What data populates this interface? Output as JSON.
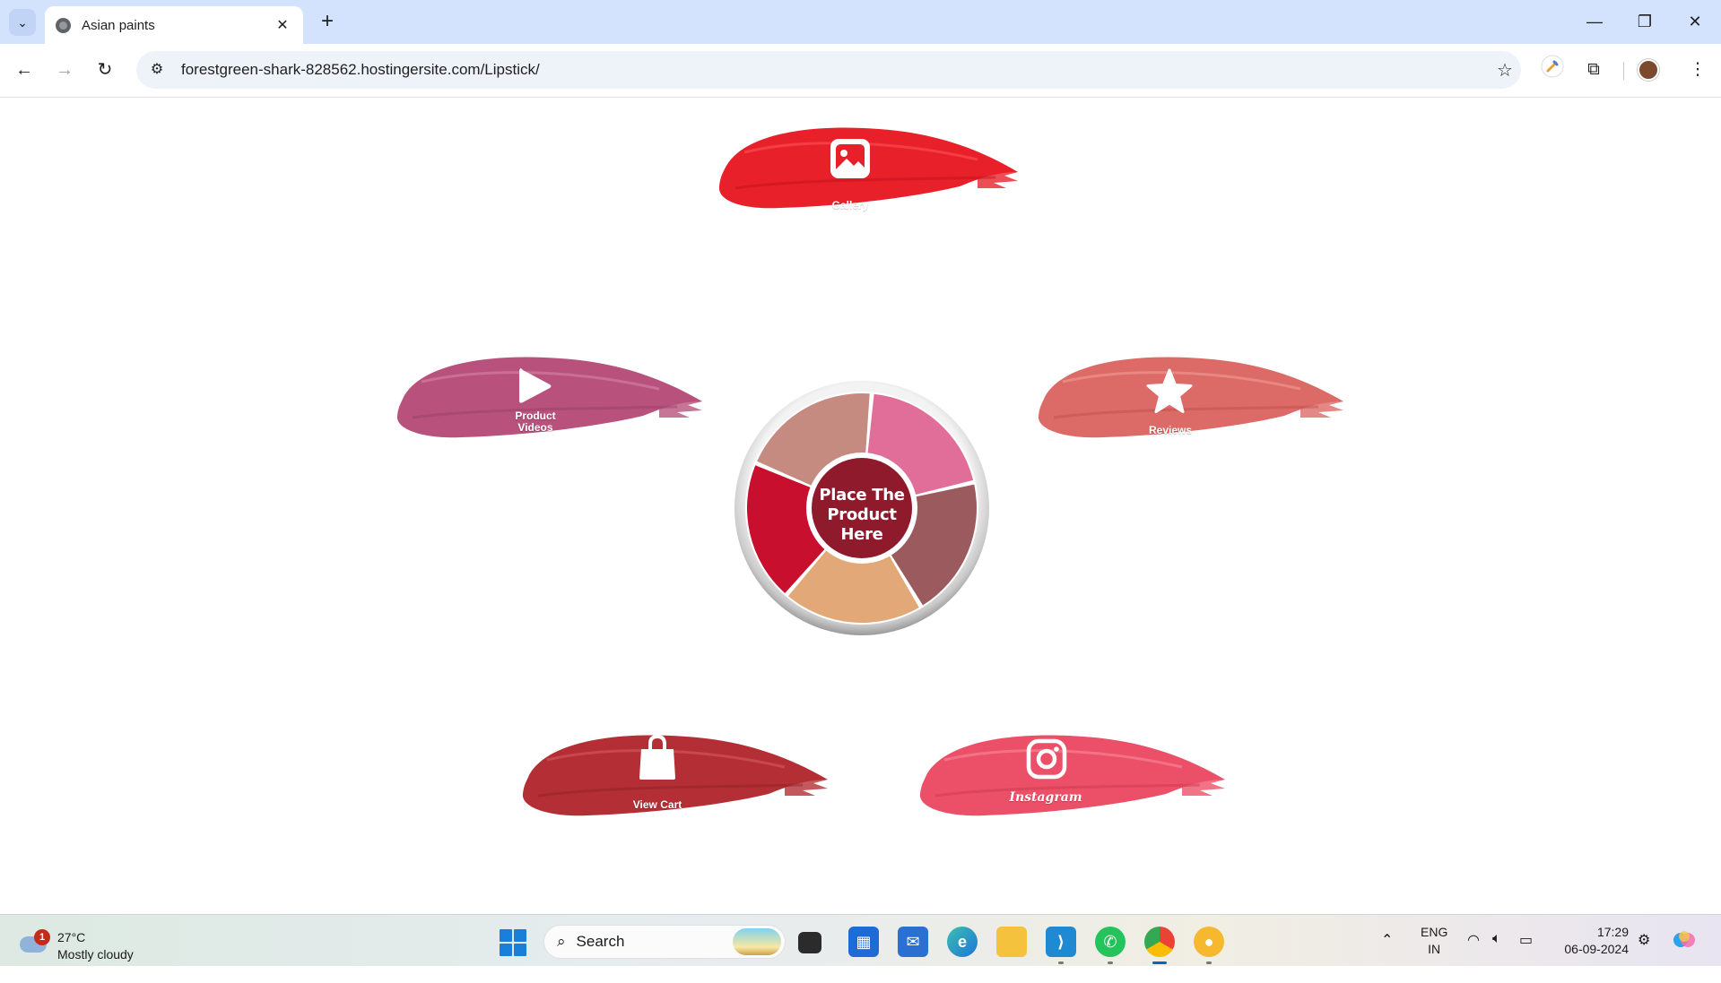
{
  "browser": {
    "tab_title": "Asian paints",
    "url": "forestgreen-shark-828562.hostingersite.com/Lipstick/",
    "tab_search_icon": "chevron-down-icon",
    "new_tab_glyph": "+",
    "close_tab_glyph": "✕"
  },
  "menu": {
    "gallery": {
      "label": "Gallery",
      "icon": "image-icon",
      "color": "#e8202a"
    },
    "product_videos": {
      "label_line1": "Product",
      "label_line2": "Videos",
      "icon": "play-icon",
      "color": "#b8527c"
    },
    "reviews": {
      "label": "Reviews",
      "icon": "star-icon",
      "color": "#dc6a66"
    },
    "view_cart": {
      "label": "View Cart",
      "icon": "shopping-bag-icon",
      "color": "#b32f35"
    },
    "instagram": {
      "label": "Instagram",
      "icon": "instagram-icon",
      "color": "#ec5068"
    }
  },
  "palette": {
    "center_line1": "Place The",
    "center_line2": "Product Here",
    "center_color": "#8e1a2c",
    "segments": [
      "#e06e98",
      "#9a5a5e",
      "#e3a878",
      "#c8102e",
      "#c58a80"
    ]
  },
  "taskbar": {
    "weather_badge": "1",
    "temperature": "27°C",
    "condition": "Mostly cloudy",
    "search_placeholder": "Search",
    "lang_line1": "ENG",
    "lang_line2": "IN",
    "time": "17:29",
    "date": "06-09-2024"
  }
}
